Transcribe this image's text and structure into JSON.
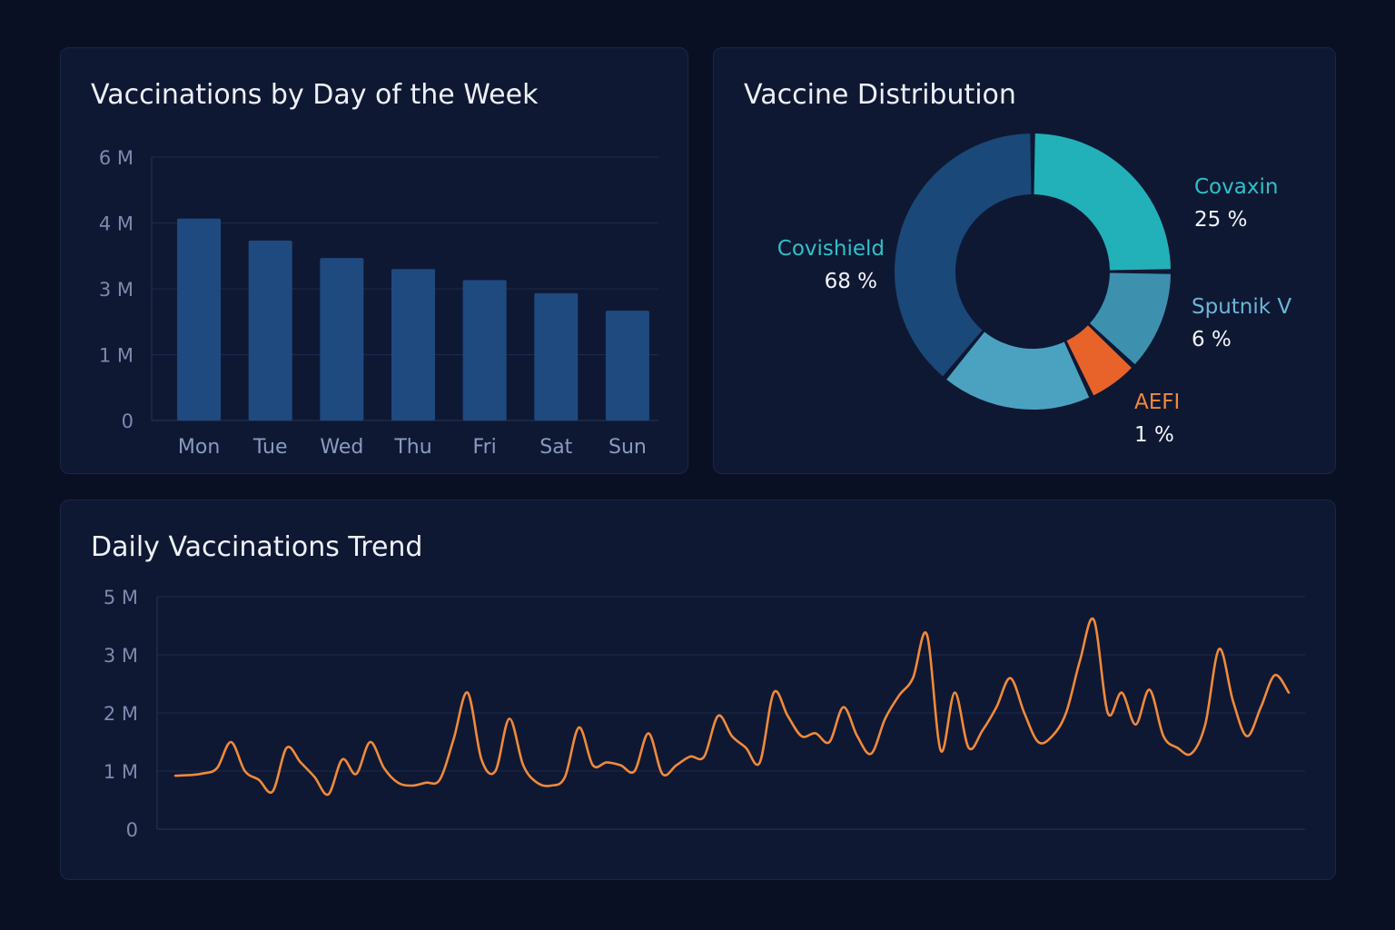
{
  "colors": {
    "bar": "#1f4a7f",
    "line": "#f08a3a",
    "Covishield": "#1a4878",
    "Covaxin": "#22b0b9",
    "Sputnik V": "#3e90af",
    "AEFI": "#e8632a",
    "unlabeled": "#4ba2c0",
    "covishield_label": "#2ec1c9",
    "covaxin_label": "#2ec1c9",
    "sputnik_label": "#6cb6d8",
    "aefi_label": "#f08a3a"
  },
  "chart_data": [
    {
      "type": "bar",
      "title": "Vaccinations by Day of the Week",
      "yticks": [
        "0",
        "1 M",
        "3 M",
        "4 M",
        "6 M"
      ],
      "categories": [
        "Mon",
        "Tue",
        "Wed",
        "Thu",
        "Fri",
        "Sat",
        "Sun"
      ],
      "values": [
        4.6,
        4.1,
        3.7,
        3.45,
        3.2,
        2.9,
        2.5
      ],
      "ylim": [
        0,
        6
      ],
      "grid": true,
      "legend": "none"
    },
    {
      "type": "pie",
      "title": "Vaccine Distribution",
      "donut": true,
      "slices": [
        {
          "name": "Covaxin",
          "label": "25 %",
          "value": 25
        },
        {
          "name": "Sputnik V",
          "label": "6 %",
          "value": 12
        },
        {
          "name": "AEFI",
          "label": "1 %",
          "value": 6
        },
        {
          "name": "",
          "label": "",
          "value": 18
        },
        {
          "name": "Covishield",
          "label": "68 %",
          "value": 39
        }
      ]
    },
    {
      "type": "line",
      "title": "Daily Vaccinations Trend",
      "yticks": [
        "0",
        "1 M",
        "2 M",
        "3 M",
        "5 M"
      ],
      "ylim": [
        0,
        4
      ],
      "grid": true,
      "legend": "none",
      "series": [
        {
          "name": "",
          "values": [
            0.92,
            0.93,
            0.96,
            1.05,
            1.5,
            1.0,
            0.85,
            0.65,
            1.4,
            1.15,
            0.9,
            0.6,
            1.2,
            0.95,
            1.5,
            1.05,
            0.8,
            0.75,
            0.8,
            0.85,
            1.55,
            2.35,
            1.2,
            1.0,
            1.9,
            1.1,
            0.8,
            0.75,
            0.9,
            1.75,
            1.1,
            1.15,
            1.1,
            1.0,
            1.65,
            0.95,
            1.1,
            1.25,
            1.25,
            1.95,
            1.6,
            1.4,
            1.15,
            2.35,
            1.95,
            1.6,
            1.65,
            1.5,
            2.1,
            1.6,
            1.3,
            1.9,
            2.3,
            2.6,
            3.35,
            1.35,
            2.35,
            1.4,
            1.7,
            2.1,
            2.6,
            2.0,
            1.5,
            1.6,
            2.0,
            2.9,
            3.6,
            2.0,
            2.35,
            1.8,
            2.4,
            1.6,
            1.4,
            1.3,
            1.8,
            3.1,
            2.2,
            1.6,
            2.1,
            2.65,
            2.35
          ]
        }
      ]
    }
  ]
}
